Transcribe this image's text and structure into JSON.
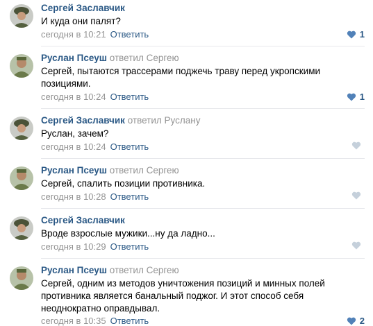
{
  "colors": {
    "link": "#2a5885",
    "muted": "#939393",
    "heart_active": "#5181b8",
    "heart_inactive": "#c5d0db"
  },
  "comments": [
    {
      "author": "Сергей Заславчик",
      "reply_to": "",
      "text": "И куда они палят?",
      "date": "сегодня в 10:21",
      "reply": "Ответить",
      "likes": "1",
      "avatar": "soldier-helmet"
    },
    {
      "author": "Руслан Псеуш",
      "reply_to": "ответил Сергею",
      "text": "Сергей, пытаются трассерами поджечь траву перед укропскими позициями.",
      "date": "сегодня в 10:24",
      "reply": "Ответить",
      "likes": "1",
      "avatar": "soldier-green"
    },
    {
      "author": "Сергей Заславчик",
      "reply_to": "ответил Руслану",
      "text": "Руслан, зачем?",
      "date": "сегодня в 10:24",
      "reply": "Ответить",
      "likes": "",
      "avatar": "soldier-helmet"
    },
    {
      "author": "Руслан Псеуш",
      "reply_to": "ответил Сергею",
      "text": "Сергей, спалить позиции противника.",
      "date": "сегодня в 10:28",
      "reply": "Ответить",
      "likes": "",
      "avatar": "soldier-green"
    },
    {
      "author": "Сергей Заславчик",
      "reply_to": "",
      "text": "Вроде взрослые мужики...ну да ладно...",
      "date": "сегодня в 10:29",
      "reply": "Ответить",
      "likes": "",
      "avatar": "soldier-helmet"
    },
    {
      "author": "Руслан Псеуш",
      "reply_to": "ответил Сергею",
      "text": "Сергей, одним из методов уничтожения позиций и минных полей противника является банальный поджог. И этот способ себя неоднократно оправдывал.",
      "date": "сегодня в 10:35",
      "reply": "Ответить",
      "likes": "2",
      "avatar": "soldier-green"
    }
  ]
}
